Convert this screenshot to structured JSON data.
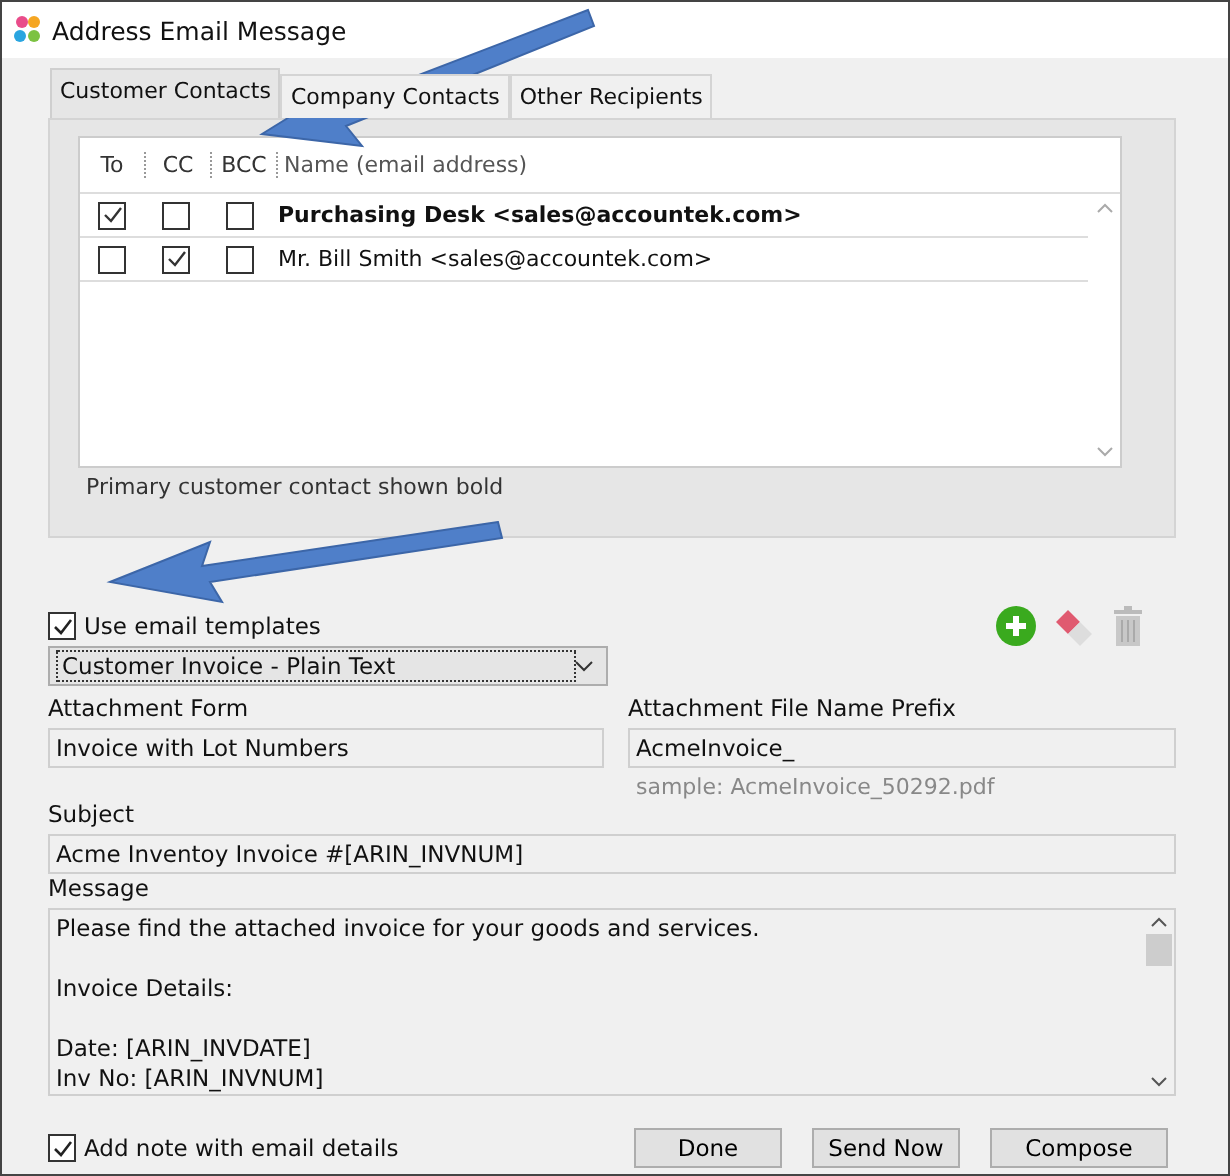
{
  "window": {
    "title": "Address Email Message"
  },
  "tabs": [
    {
      "label": "Customer Contacts",
      "selected": true
    },
    {
      "label": "Company Contacts",
      "selected": false
    },
    {
      "label": "Other Recipients",
      "selected": false
    }
  ],
  "contacts": {
    "columns": [
      "To",
      "CC",
      "BCC",
      "Name (email address)"
    ],
    "rows": [
      {
        "to": true,
        "cc": false,
        "bcc": false,
        "name": "Purchasing Desk <sales@accountek.com>",
        "primary": true
      },
      {
        "to": false,
        "cc": true,
        "bcc": false,
        "name": "Mr. Bill Smith <sales@accountek.com>",
        "primary": false
      }
    ],
    "note": "Primary customer contact shown bold"
  },
  "use_templates": {
    "label": "Use email templates",
    "checked": true
  },
  "template": {
    "value": "Customer Invoice - Plain Text"
  },
  "attachment_form": {
    "label": "Attachment Form",
    "value": "Invoice with Lot Numbers"
  },
  "prefix": {
    "label": "Attachment File Name Prefix",
    "value": "AcmeInvoice_",
    "sample": "sample: AcmeInvoice_50292.pdf"
  },
  "subject": {
    "label": "Subject",
    "value": "Acme Inventoy Invoice #[ARIN_INVNUM]"
  },
  "message": {
    "label": "Message",
    "paragraphs": [
      [
        "Please find the attached invoice for your goods and services."
      ],
      [
        "Invoice Details:"
      ],
      [
        "Date: [ARIN_INVDATE]",
        "Inv No: [ARIN_INVNUM]"
      ]
    ]
  },
  "add_note": {
    "label": "Add note with email details",
    "checked": true
  },
  "buttons": [
    "Done",
    "Send Now",
    "Compose"
  ]
}
